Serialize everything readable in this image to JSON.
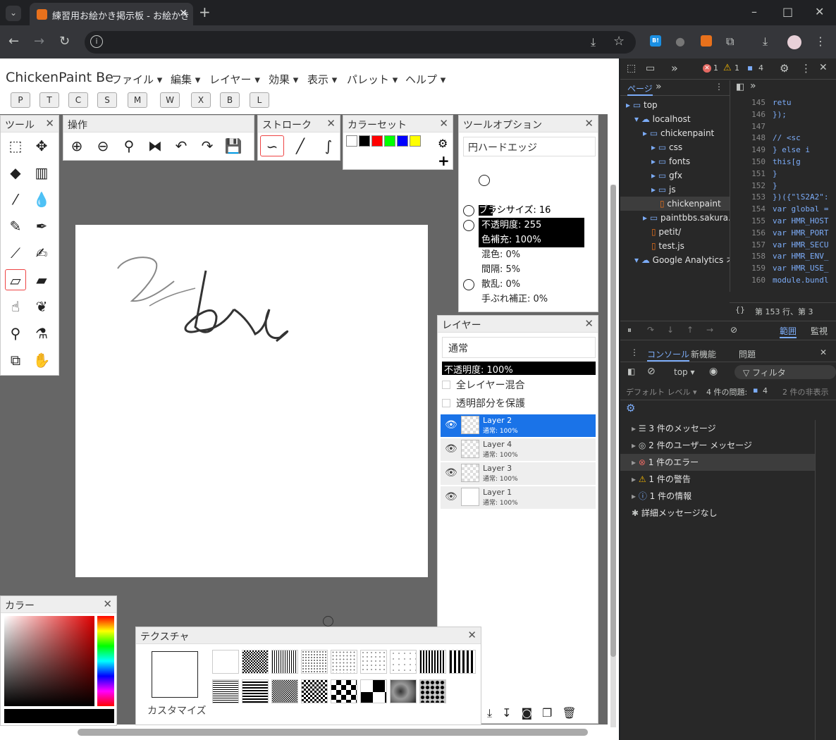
{
  "browser": {
    "tab_title": "練習用お絵かき掲示板 - お絵かき",
    "new_tab": "+",
    "window_controls": [
      "–",
      "□",
      "✕"
    ]
  },
  "app": {
    "title": "ChickenPaint Be",
    "menus": [
      "ファイル ▾",
      "編集 ▾",
      "レイヤー ▾",
      "効果 ▾",
      "表示 ▾",
      "パレット ▾",
      "ヘルプ ▾"
    ],
    "shortcut_buttons": [
      "P",
      "T",
      "C",
      "S",
      "M",
      "W",
      "X",
      "B",
      "L"
    ]
  },
  "panels": {
    "tools": {
      "title": "ツール"
    },
    "operations": {
      "title": "操作"
    },
    "stroke": {
      "title": "ストローク"
    },
    "colorset": {
      "title": "カラーセット",
      "swatches": [
        "#ffffff",
        "#000000",
        "#ff0000",
        "#00ff00",
        "#0000ff",
        "#ffff00"
      ]
    },
    "tool_options": {
      "title": "ツールオプション",
      "brush_type": "円ハードエッジ",
      "brush_size": "ブラシサイズ: 16",
      "opacity": "不透明度: 255",
      "color_fill": "色補充: 100%",
      "blend": "混色: 0%",
      "spacing": "間隔: 5%",
      "scatter": "散乱: 0%",
      "smoothing": "手ぶれ補正: 0%"
    },
    "layers": {
      "title": "レイヤー",
      "blend_mode": "通常",
      "opacity": "不透明度: 100%",
      "sample_all": "全レイヤー混合",
      "lock_alpha": "透明部分を保護",
      "items": [
        {
          "name": "Layer 2",
          "sub": "通常: 100%",
          "selected": true
        },
        {
          "name": "Layer 4",
          "sub": "通常: 100%",
          "selected": false
        },
        {
          "name": "Layer 3",
          "sub": "通常: 100%",
          "selected": false
        },
        {
          "name": "Layer 1",
          "sub": "通常: 100%",
          "selected": false
        }
      ]
    },
    "color": {
      "title": "カラー"
    },
    "texture": {
      "title": "テクスチャ",
      "customize": "カスタマイズ"
    }
  },
  "devtools": {
    "error_count": "1",
    "warning_count": "1",
    "message_count": "4",
    "sources_tab": "ページ",
    "tree": [
      {
        "label": "top",
        "depth": 0,
        "kind": "folder"
      },
      {
        "label": "localhost",
        "depth": 1,
        "kind": "cloud"
      },
      {
        "label": "chickenpaint",
        "depth": 2,
        "kind": "folder"
      },
      {
        "label": "css",
        "depth": 3,
        "kind": "folder"
      },
      {
        "label": "fonts",
        "depth": 3,
        "kind": "folder"
      },
      {
        "label": "gfx",
        "depth": 3,
        "kind": "folder"
      },
      {
        "label": "js",
        "depth": 3,
        "kind": "folder"
      },
      {
        "label": "chickenpaint",
        "depth": 4,
        "kind": "file"
      },
      {
        "label": "paintbbs.sakura.n",
        "depth": 2,
        "kind": "folder"
      },
      {
        "label": "petit/",
        "depth": 3,
        "kind": "file"
      },
      {
        "label": "test.js",
        "depth": 3,
        "kind": "file"
      },
      {
        "label": "Google Analytics オ",
        "depth": 1,
        "kind": "cloud"
      }
    ],
    "line_numbers": [
      "145",
      "146",
      "147",
      "148",
      "149",
      "150",
      "151",
      "152",
      "153",
      "154",
      "155",
      "156",
      "157",
      "158",
      "159",
      "160"
    ],
    "code_lines": [
      "      retu",
      "   });",
      "",
      "   // <sc",
      " } else i",
      "   this[g",
      "   }",
      " }",
      "})({\"lS2A2\":",
      "var global =",
      "var HMR_HOST",
      "var HMR_PORT",
      "var HMR_SECU",
      "var HMR_ENV_",
      "var HMR_USE_",
      "module.bundl"
    ],
    "cursor_position": "第 153 行、第 3",
    "scope_tab": "範囲",
    "watch_tab": "監視",
    "drawer_tabs": [
      "コンソール",
      "新機能",
      "問題"
    ],
    "console_context": "top ▾",
    "filter_placeholder": "フィルタ",
    "default_levels": "デフォルト レベル ▾",
    "issues": "4 件の問題:",
    "issues_count": "4",
    "hidden": "2 件の非表示",
    "sidebar_items": [
      {
        "label": "3 件のメッセージ",
        "icon": "list-icon"
      },
      {
        "label": "2 件のユーザー メッセージ",
        "icon": "user-icon"
      },
      {
        "label": "1 件のエラー",
        "icon": "error-icon"
      },
      {
        "label": "1 件の警告",
        "icon": "warning-icon"
      },
      {
        "label": "1 件の情報",
        "icon": "info-icon"
      },
      {
        "label": "詳細メッセージなし",
        "icon": "bug-icon"
      }
    ]
  }
}
